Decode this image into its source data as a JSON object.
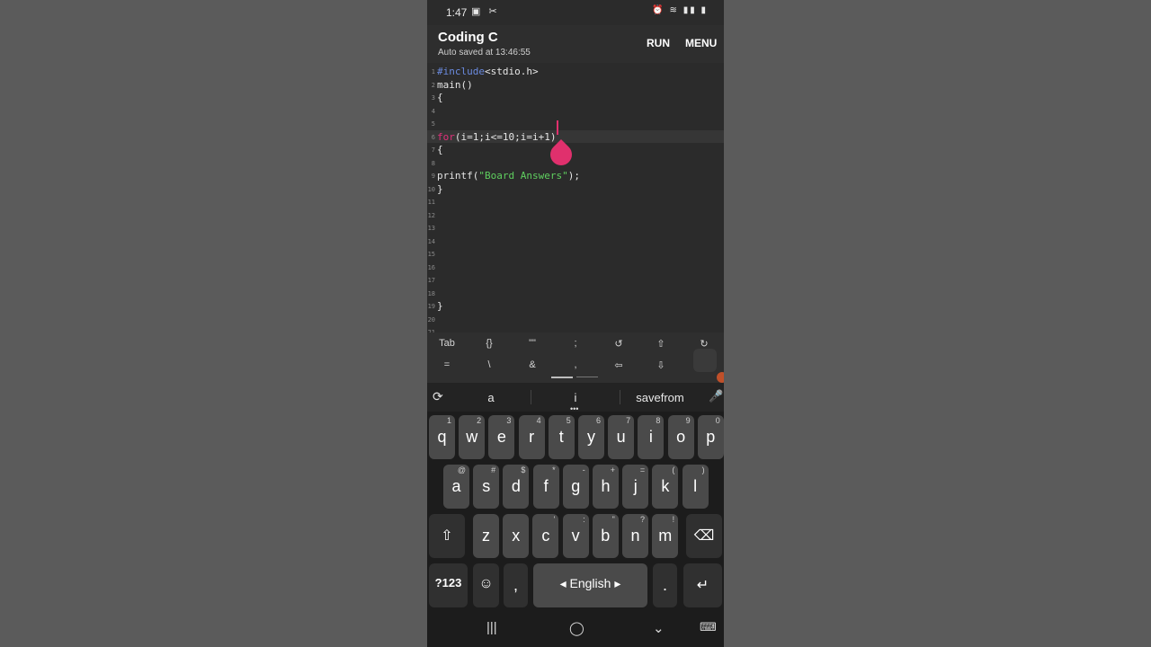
{
  "status_bar": {
    "time": "1:47",
    "left_icons": "▣ ✂",
    "right_icons": "⏰ ≋ ▮▮ ▮"
  },
  "app": {
    "title": "Coding C",
    "subtitle": "Auto saved at 13:46:55",
    "run_label": "RUN",
    "menu_label": "MENU"
  },
  "editor": {
    "line_numbers": [
      "1",
      "2",
      "3",
      "4",
      "5",
      "6",
      "7",
      "8",
      "9",
      "10",
      "11",
      "12",
      "13",
      "14",
      "15",
      "16",
      "17",
      "18",
      "19",
      "20",
      "21"
    ],
    "lines": [
      {
        "a": "#include",
        "b": "<stdio.h>"
      },
      {
        "a": "",
        "b": "main()"
      },
      {
        "a": "",
        "b": "{"
      },
      {
        "a": "",
        "b": ""
      },
      {
        "a": "",
        "b": ""
      },
      {
        "a": "for",
        "b": "(i=1;i<=10;i=i+1)"
      },
      {
        "a": "",
        "b": "{"
      },
      {
        "a": "",
        "b": ""
      },
      {
        "a": "printf(",
        "b": "\"Board Answers\"",
        "c": ");"
      },
      {
        "a": "",
        "b": "}"
      },
      {
        "a": "",
        "b": ""
      },
      {
        "a": "",
        "b": ""
      },
      {
        "a": "",
        "b": ""
      },
      {
        "a": "",
        "b": ""
      },
      {
        "a": "",
        "b": ""
      },
      {
        "a": "",
        "b": ""
      },
      {
        "a": "",
        "b": ""
      },
      {
        "a": "",
        "b": ""
      },
      {
        "a": "",
        "b": "}"
      },
      {
        "a": "",
        "b": ""
      },
      {
        "a": "",
        "b": ""
      }
    ],
    "active_line": 6
  },
  "extra_keys": {
    "row1": [
      "Tab",
      "{}",
      "\"\"",
      ";",
      "↺",
      "⇧",
      "↻"
    ],
    "row2": [
      "=",
      "\\",
      "&",
      ",",
      "⇦",
      "⇩",
      ""
    ]
  },
  "suggestions": {
    "items": [
      "a",
      "i",
      "savefrom"
    ],
    "left_icon": "⟳",
    "mic_icon": "🎤",
    "dots": "•••"
  },
  "keyboard": {
    "row1": [
      {
        "k": "q",
        "h": "1"
      },
      {
        "k": "w",
        "h": "2"
      },
      {
        "k": "e",
        "h": "3"
      },
      {
        "k": "r",
        "h": "4"
      },
      {
        "k": "t",
        "h": "5"
      },
      {
        "k": "y",
        "h": "6"
      },
      {
        "k": "u",
        "h": "7"
      },
      {
        "k": "i",
        "h": "8"
      },
      {
        "k": "o",
        "h": "9"
      },
      {
        "k": "p",
        "h": "0"
      }
    ],
    "row2": [
      {
        "k": "a",
        "h": "@"
      },
      {
        "k": "s",
        "h": "#"
      },
      {
        "k": "d",
        "h": "$"
      },
      {
        "k": "f",
        "h": "*"
      },
      {
        "k": "g",
        "h": "-"
      },
      {
        "k": "h",
        "h": "+"
      },
      {
        "k": "j",
        "h": "="
      },
      {
        "k": "k",
        "h": "("
      },
      {
        "k": "l",
        "h": ")"
      }
    ],
    "row3": [
      {
        "k": "z",
        "h": ""
      },
      {
        "k": "x",
        "h": ""
      },
      {
        "k": "c",
        "h": "'"
      },
      {
        "k": "v",
        "h": ":"
      },
      {
        "k": "b",
        "h": "\""
      },
      {
        "k": "n",
        "h": "?"
      },
      {
        "k": "m",
        "h": "!"
      }
    ],
    "shift": "⇧",
    "backspace": "⌫",
    "symbols": "?123",
    "emoji": "☺",
    "comma": ",",
    "space": "◂ English ▸",
    "period": ".",
    "enter": "↵"
  },
  "navbar": {
    "recents": "|||",
    "home": "◯",
    "back": "⌄",
    "keyboard": "⌨"
  },
  "colors": {
    "keyword_blue": "#6b8be0",
    "keyword_pink": "#e0307a",
    "string_green": "#5fcf5f",
    "cursor": "#e0306d"
  }
}
